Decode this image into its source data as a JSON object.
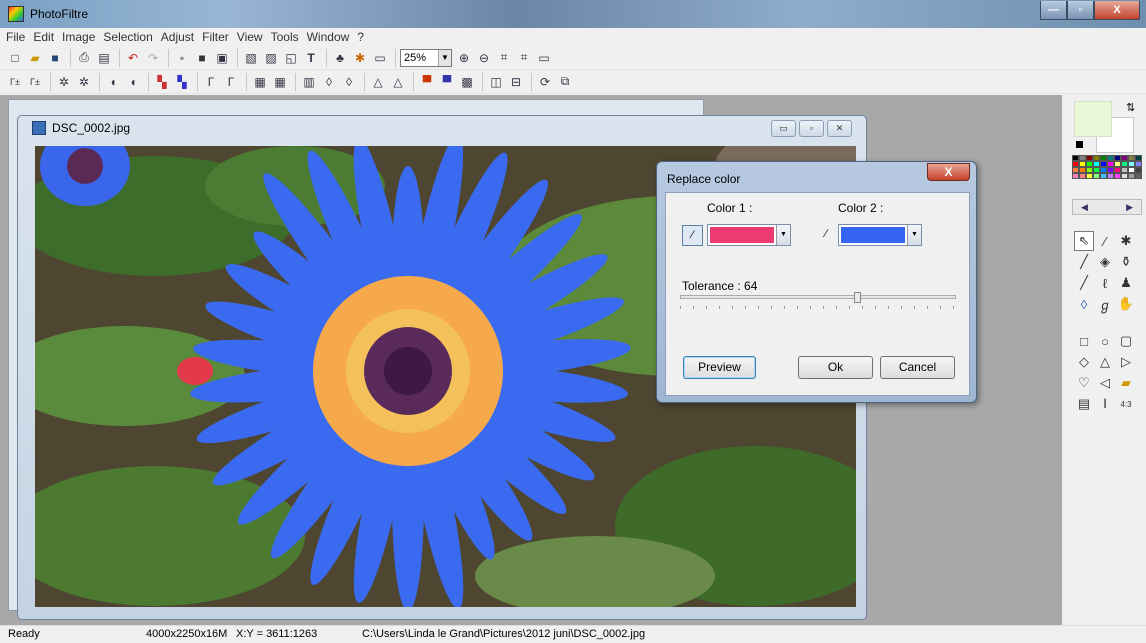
{
  "app": {
    "title": "PhotoFiltre",
    "icon": "photofiltre-app-icon"
  },
  "window_buttons": {
    "minimize": "—",
    "maximize": "▫",
    "close": "X"
  },
  "menu": [
    "File",
    "Edit",
    "Image",
    "Selection",
    "Adjust",
    "Filter",
    "View",
    "Tools",
    "Window",
    "?"
  ],
  "toolbar1": {
    "zoom": "25%",
    "icons": [
      "new-icon",
      "open-icon",
      "save-icon",
      "print-icon",
      "scan-icon",
      "undo-icon",
      "redo-icon",
      "image-icon",
      "gradient-icon",
      "mask-icon",
      "copy-icon",
      "paste-icon",
      "crop-icon",
      "text-icon",
      "plugin-icon",
      "effect-icon",
      "window-icon",
      "zoom-in-icon",
      "zoom-out-icon",
      "fit-icon",
      "fullscreen-icon",
      "slideshow-icon"
    ]
  },
  "toolbar2": {
    "icons": [
      "auto-levels-icon",
      "auto-contrast-icon",
      "brightness-minus-icon",
      "brightness-plus-icon",
      "contrast-minus-icon",
      "contrast-plus-icon",
      "saturation-minus-icon",
      "saturation-plus-icon",
      "gamma-minus-icon",
      "gamma-plus-icon",
      "grayscale-icon",
      "sepia-icon",
      "blur-icon",
      "drop-icon",
      "sharpen-icon",
      "triangle-icon",
      "triangle-plus-icon",
      "flag-icon",
      "flag-alt-icon",
      "texture-icon",
      "mirror-icon",
      "flip-icon",
      "rotate-icon",
      "resize-icon"
    ]
  },
  "document": {
    "title": "DSC_0002.jpg",
    "buttons": {
      "minimize": "▭",
      "restore": "▫",
      "close": "✕"
    },
    "palette": {
      "petals": "#3a6af0",
      "petal_edge": "#ee3a5a",
      "center_outer": "#f7b04a",
      "center_inner": "#4b1f55",
      "leaves": "#3f7a2a",
      "soil": "#5a4a3a"
    }
  },
  "dialog": {
    "title": "Replace color",
    "close": "X",
    "color1_label": "Color 1 :",
    "color2_label": "Color 2 :",
    "color1": "#ee3a72",
    "color2": "#3565f2",
    "tolerance_label": "Tolerance : 64",
    "tolerance": 64,
    "tolerance_max": 100,
    "buttons": {
      "preview": "Preview",
      "ok": "Ok",
      "cancel": "Cancel"
    }
  },
  "right_panel": {
    "foreground_color": "#e8f8d8",
    "background_color": "#ffffff",
    "palette_colors": [
      "#000000",
      "#808080",
      "#800000",
      "#808000",
      "#008000",
      "#008080",
      "#000080",
      "#800080",
      "#808040",
      "#004040",
      "#ff0000",
      "#ffff00",
      "#00ff00",
      "#00ffff",
      "#0000ff",
      "#ff00ff",
      "#ffff80",
      "#00ff80",
      "#80ffff",
      "#8080ff",
      "#ff8040",
      "#ff8000",
      "#80ff00",
      "#00ff40",
      "#0080ff",
      "#8000ff",
      "#ff0080",
      "#c0c0c0",
      "#ffffff",
      "#404040",
      "#ff80c0",
      "#ff8080",
      "#ffff40",
      "#80ff80",
      "#40c0ff",
      "#c080ff",
      "#ff40ff",
      "#e0e0e0",
      "#a0a0a0",
      "#606060"
    ],
    "tools": [
      "pointer-icon",
      "eyedropper-icon",
      "magic-wand-icon",
      "line-icon",
      "fill-icon",
      "spray-icon",
      "brush-icon",
      "advanced-brush-icon",
      "stamp-icon",
      "blur-drop-icon",
      "smudge-icon",
      "hand-icon"
    ],
    "shapes": [
      "rectangle-icon",
      "ellipse-icon",
      "rounded-rect-icon",
      "diamond-icon",
      "triangle-icon",
      "arrow-icon",
      "lasso-icon",
      "polygon-icon",
      "open-shape-icon",
      "selection-icon",
      "text-frame-icon",
      "ratio-icon"
    ]
  },
  "status": {
    "state": "Ready",
    "size": "4000x2250x16M",
    "coords": "X:Y = 3611:1263",
    "path": "C:\\Users\\Linda le Grand\\Pictures\\2012 juni\\DSC_0002.jpg"
  }
}
